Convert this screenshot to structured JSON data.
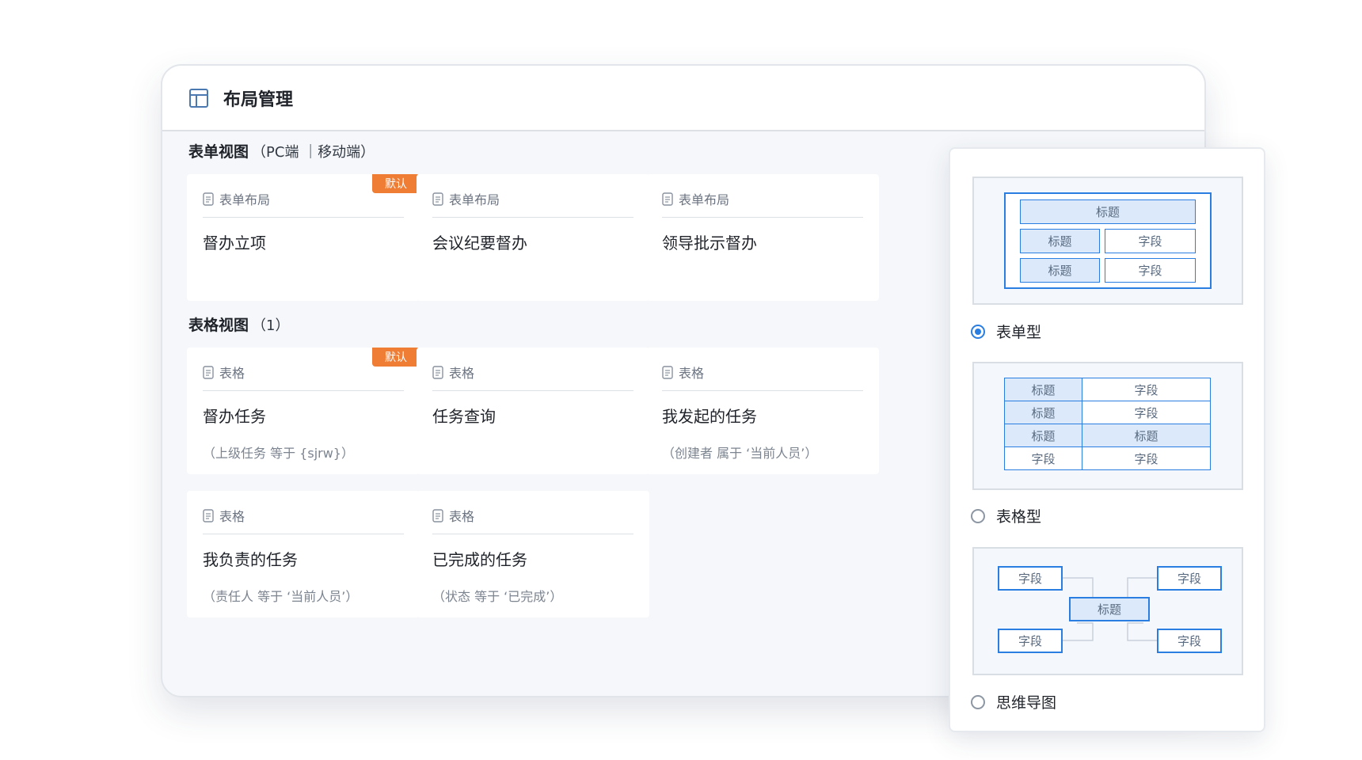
{
  "window": {
    "title": "布局管理",
    "icon": "layout-icon"
  },
  "form_section": {
    "title": "表单视图",
    "subtitle": "（PC端 ｜移动端）",
    "cards": [
      {
        "type": "表单布局",
        "title": "督办立项",
        "badge": "默认"
      },
      {
        "type": "表单布局",
        "title": "会议纪要督办"
      },
      {
        "type": "表单布局",
        "title": "领导批示督办"
      }
    ]
  },
  "table_section": {
    "title": "表格视图",
    "subtitle": "（1）",
    "cards": [
      {
        "type": "表格",
        "title": "督办任务",
        "condition": "（上级任务 等于 {sjrw}）",
        "badge": "默认"
      },
      {
        "type": "表格",
        "title": "任务查询"
      },
      {
        "type": "表格",
        "title": "我发起的任务",
        "condition": "（创建者 属于 ‘当前人员’）"
      },
      {
        "type": "表格",
        "title": "我负责的任务",
        "condition": "（责任人 等于 ‘当前人员’）"
      },
      {
        "type": "表格",
        "title": "已完成的任务",
        "condition": "（状态 等于 ‘已完成’）"
      }
    ]
  },
  "layout_panel": {
    "options": [
      {
        "label": "表单型",
        "selected": true,
        "preview": {
          "title_row": "标题",
          "rows": [
            [
              "标题",
              "字段"
            ],
            [
              "标题",
              "字段"
            ]
          ]
        }
      },
      {
        "label": "表格型",
        "selected": false,
        "preview": {
          "rows": [
            [
              "标题",
              "字段"
            ],
            [
              "标题",
              "字段"
            ],
            [
              "标题",
              "标题"
            ],
            [
              "字段",
              "字段"
            ]
          ]
        }
      },
      {
        "label": "思维导图",
        "selected": false,
        "preview": {
          "center": "标题",
          "nodes": [
            "字段",
            "字段",
            "字段",
            "字段"
          ]
        }
      }
    ]
  },
  "colors": {
    "accent": "#2a7de1",
    "badge": "#f07d34",
    "title_cell_fill": "#dbe9fb"
  }
}
